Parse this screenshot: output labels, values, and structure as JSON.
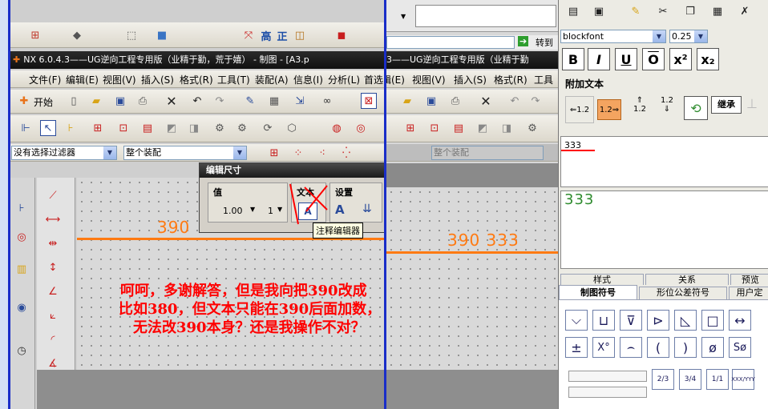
{
  "nx": {
    "title": "NX 6.0.4.3——UG逆向工程专用版（业精于勤，荒于嬉） - 制图 - [A3.p",
    "title_dup": "3——UG逆向工程专用版（业精于勤",
    "menu": [
      "文件(F)",
      "编辑(E)",
      "视图(V)",
      "插入(S)",
      "格式(R)",
      "工具(T)",
      "装配(A)",
      "信息(I)",
      "分析(L)",
      "首选"
    ],
    "menu_dup": [
      "编辑(E)",
      "视图(V)",
      "插入(S)",
      "格式(R)",
      "工具"
    ],
    "start_label": "开始",
    "filter_value": "没有选择过滤器",
    "assembly_value": "整个装配",
    "assembly_dup": "整个装配",
    "tab_fragment": "转到"
  },
  "dialog": {
    "title": "编辑尺寸",
    "value_group": "值",
    "text_group": "文本",
    "settings_group": "设置",
    "tolerance_value": "1.00",
    "tolerance_small": "1",
    "tooltip": "注释编辑器"
  },
  "drawing": {
    "dimension_left": "390",
    "dimension_right": "390 333"
  },
  "annotation": {
    "line1": "呵呵，多谢解答，但是我向把390改成",
    "line2": "比如380，但文本只能在390后面加数，",
    "line3": "无法改390本身？还是我操作不对？"
  },
  "editor": {
    "font_value": "blockfont",
    "size_value": "0.25",
    "format_buttons": [
      "B",
      "I",
      "U",
      "O",
      "x²",
      "x₂"
    ],
    "append_label": "附加文本",
    "inherit_label": "继承",
    "text_value": "333",
    "preview_value": "333",
    "tabs_row1": [
      "样式",
      "关系",
      "预览"
    ],
    "tabs_row2": [
      "制图符号",
      "形位公差符号",
      "用户定"
    ],
    "symbols_row1": [
      "⌵",
      "⊔",
      "⊽",
      "⊳",
      "◺",
      "□",
      "↔"
    ],
    "symbols_row2": [
      "±",
      "X°",
      "⌢",
      "(",
      ")",
      "ø",
      "Sø"
    ],
    "fraction_labels": [
      "2/3",
      "3/4",
      "1/1",
      "XXX/YYY"
    ],
    "stack_labels": [
      "1.2",
      "1.2",
      "1.2",
      "1.2"
    ]
  },
  "colors": {
    "orange": "#ff7a12",
    "annotation_red": "#ff0000",
    "preview_green": "#2e8b2e",
    "nx_blue": "#2140c4"
  }
}
